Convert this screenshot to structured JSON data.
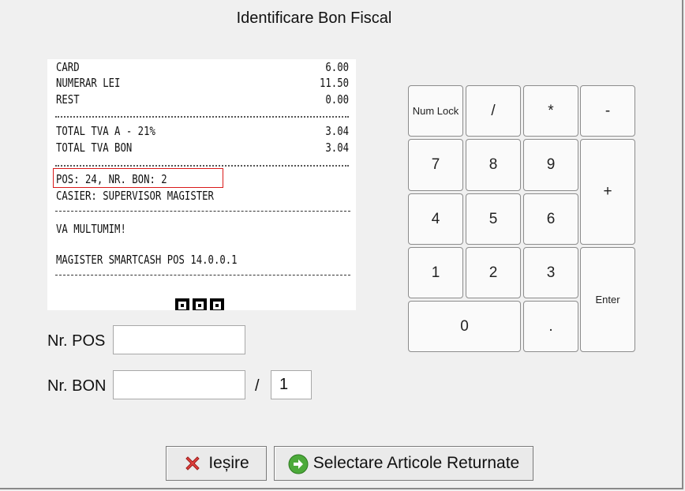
{
  "window": {
    "title": "Identificare Bon Fiscal"
  },
  "receipt": {
    "lines": [
      {
        "left": "CARD",
        "right": "6.00"
      },
      {
        "left": "NUMERAR LEI",
        "right": "11.50"
      },
      {
        "left": "REST",
        "right": "0.00"
      },
      {
        "left": "TOTAL TVA A - 21%",
        "right": "3.04"
      },
      {
        "left": "TOTAL TVA BON",
        "right": "3.04"
      },
      {
        "left": "POS: 24, NR. BON: 2",
        "right": ""
      },
      {
        "left": "CASIER: SUPERVISOR MAGISTER",
        "right": ""
      },
      {
        "left": "VA MULTUMIM!",
        "right": ""
      },
      {
        "left": "MAGISTER SMARTCASH POS 14.0.0.1",
        "right": ""
      }
    ],
    "highlight_color": "#d91a1a"
  },
  "form": {
    "pos_label": "Nr. POS",
    "pos_value": "",
    "bon_label": "Nr. BON",
    "bon_value": "",
    "separator": "/",
    "bon_suffix_value": "1"
  },
  "keypad": {
    "num_lock": "Num Lock",
    "divide": "/",
    "multiply": "*",
    "minus": "-",
    "plus": "+",
    "enter": "Enter",
    "k7": "7",
    "k8": "8",
    "k9": "9",
    "k4": "4",
    "k5": "5",
    "k6": "6",
    "k1": "1",
    "k2": "2",
    "k3": "3",
    "k0": "0",
    "dot": "."
  },
  "buttons": {
    "exit_label": "Ieșire",
    "exit_icon": "red-x-icon",
    "select_label": "Selectare Articole Returnate",
    "select_icon": "green-arrow-icon"
  }
}
